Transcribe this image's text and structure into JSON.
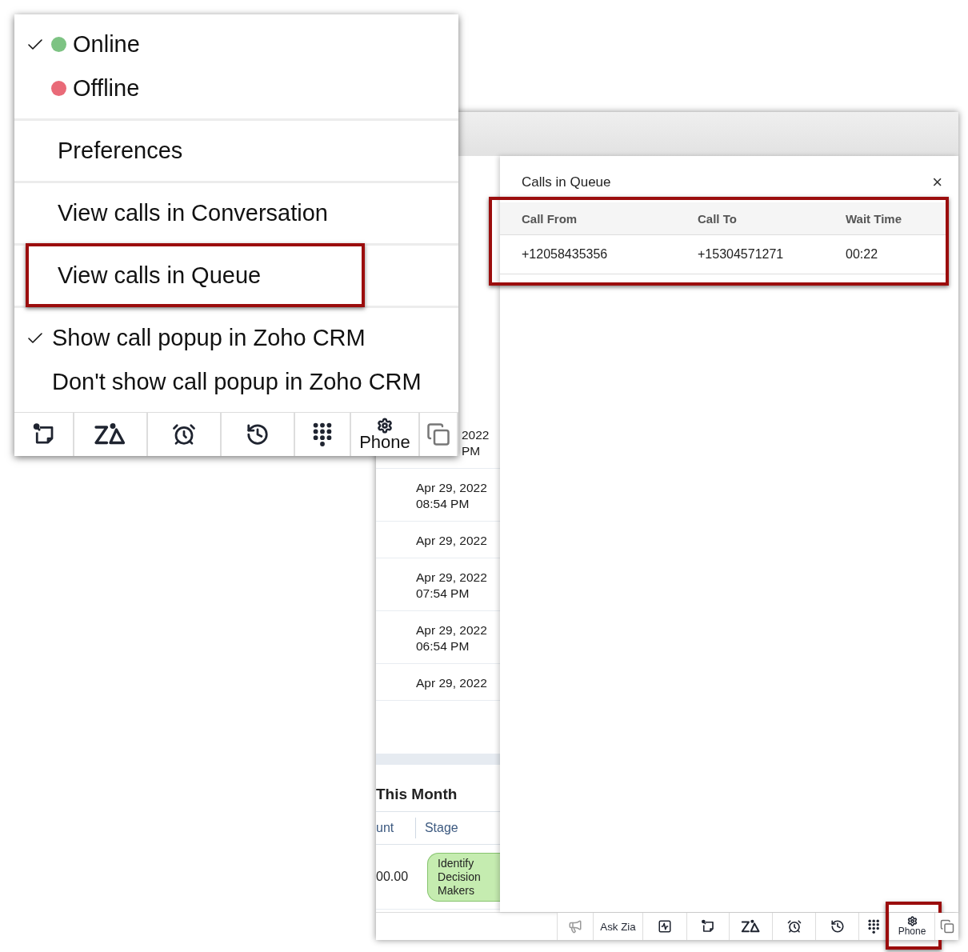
{
  "status_menu": {
    "statuses": [
      {
        "label": "Online",
        "checked": true,
        "color": "#7dc383"
      },
      {
        "label": "Offline",
        "checked": false,
        "color": "#e96a78"
      }
    ],
    "items": [
      {
        "label": "Preferences",
        "highlighted": false
      },
      {
        "label": "View calls in Conversation",
        "highlighted": false
      },
      {
        "label": "View calls in Queue",
        "highlighted": true
      }
    ],
    "popup_options": [
      {
        "label": "Show call popup in Zoho CRM",
        "checked": true
      },
      {
        "label": "Don't show call popup in Zoho CRM",
        "checked": false
      }
    ],
    "toolbar": [
      {
        "kind": "note"
      },
      {
        "kind": "zia"
      },
      {
        "kind": "alarm"
      },
      {
        "kind": "history"
      },
      {
        "kind": "dialpad"
      },
      {
        "kind": "phone",
        "label": "Phone",
        "highlighted": false
      },
      {
        "kind": "stack"
      }
    ]
  },
  "background_list": {
    "rows": [
      {
        "kind": "partial",
        "lines": [
          "2022",
          "PM"
        ]
      },
      {
        "kind": "full",
        "lines": [
          "Apr 29, 2022",
          "08:54 PM"
        ]
      },
      {
        "kind": "full",
        "lines": [
          "Apr 29, 2022"
        ]
      },
      {
        "kind": "full",
        "lines": [
          "Apr 29, 2022",
          "07:54 PM"
        ]
      },
      {
        "kind": "full",
        "lines": [
          "Apr 29, 2022",
          "06:54 PM"
        ]
      },
      {
        "kind": "full",
        "lines": [
          "Apr 29, 2022"
        ]
      }
    ],
    "section_title": "This Month",
    "columns": [
      "unt",
      "Stage"
    ],
    "cells": [
      "00.00",
      "Identify Decision Makers"
    ]
  },
  "queue_panel": {
    "title": "Calls in Queue",
    "close": "×",
    "highlighted": true,
    "columns": [
      "Call From",
      "Call To",
      "Wait Time"
    ],
    "rows": [
      [
        "+12058435356",
        "+15304571271",
        "00:22"
      ]
    ]
  },
  "bottom_toolbar": [
    {
      "kind": "megaphone"
    },
    {
      "kind": "text",
      "label": "Ask Zia"
    },
    {
      "kind": "chart"
    },
    {
      "kind": "note"
    },
    {
      "kind": "zia"
    },
    {
      "kind": "alarm"
    },
    {
      "kind": "history"
    },
    {
      "kind": "dialpad"
    },
    {
      "kind": "phone",
      "label": "Phone",
      "highlighted": true
    },
    {
      "kind": "stack"
    }
  ]
}
